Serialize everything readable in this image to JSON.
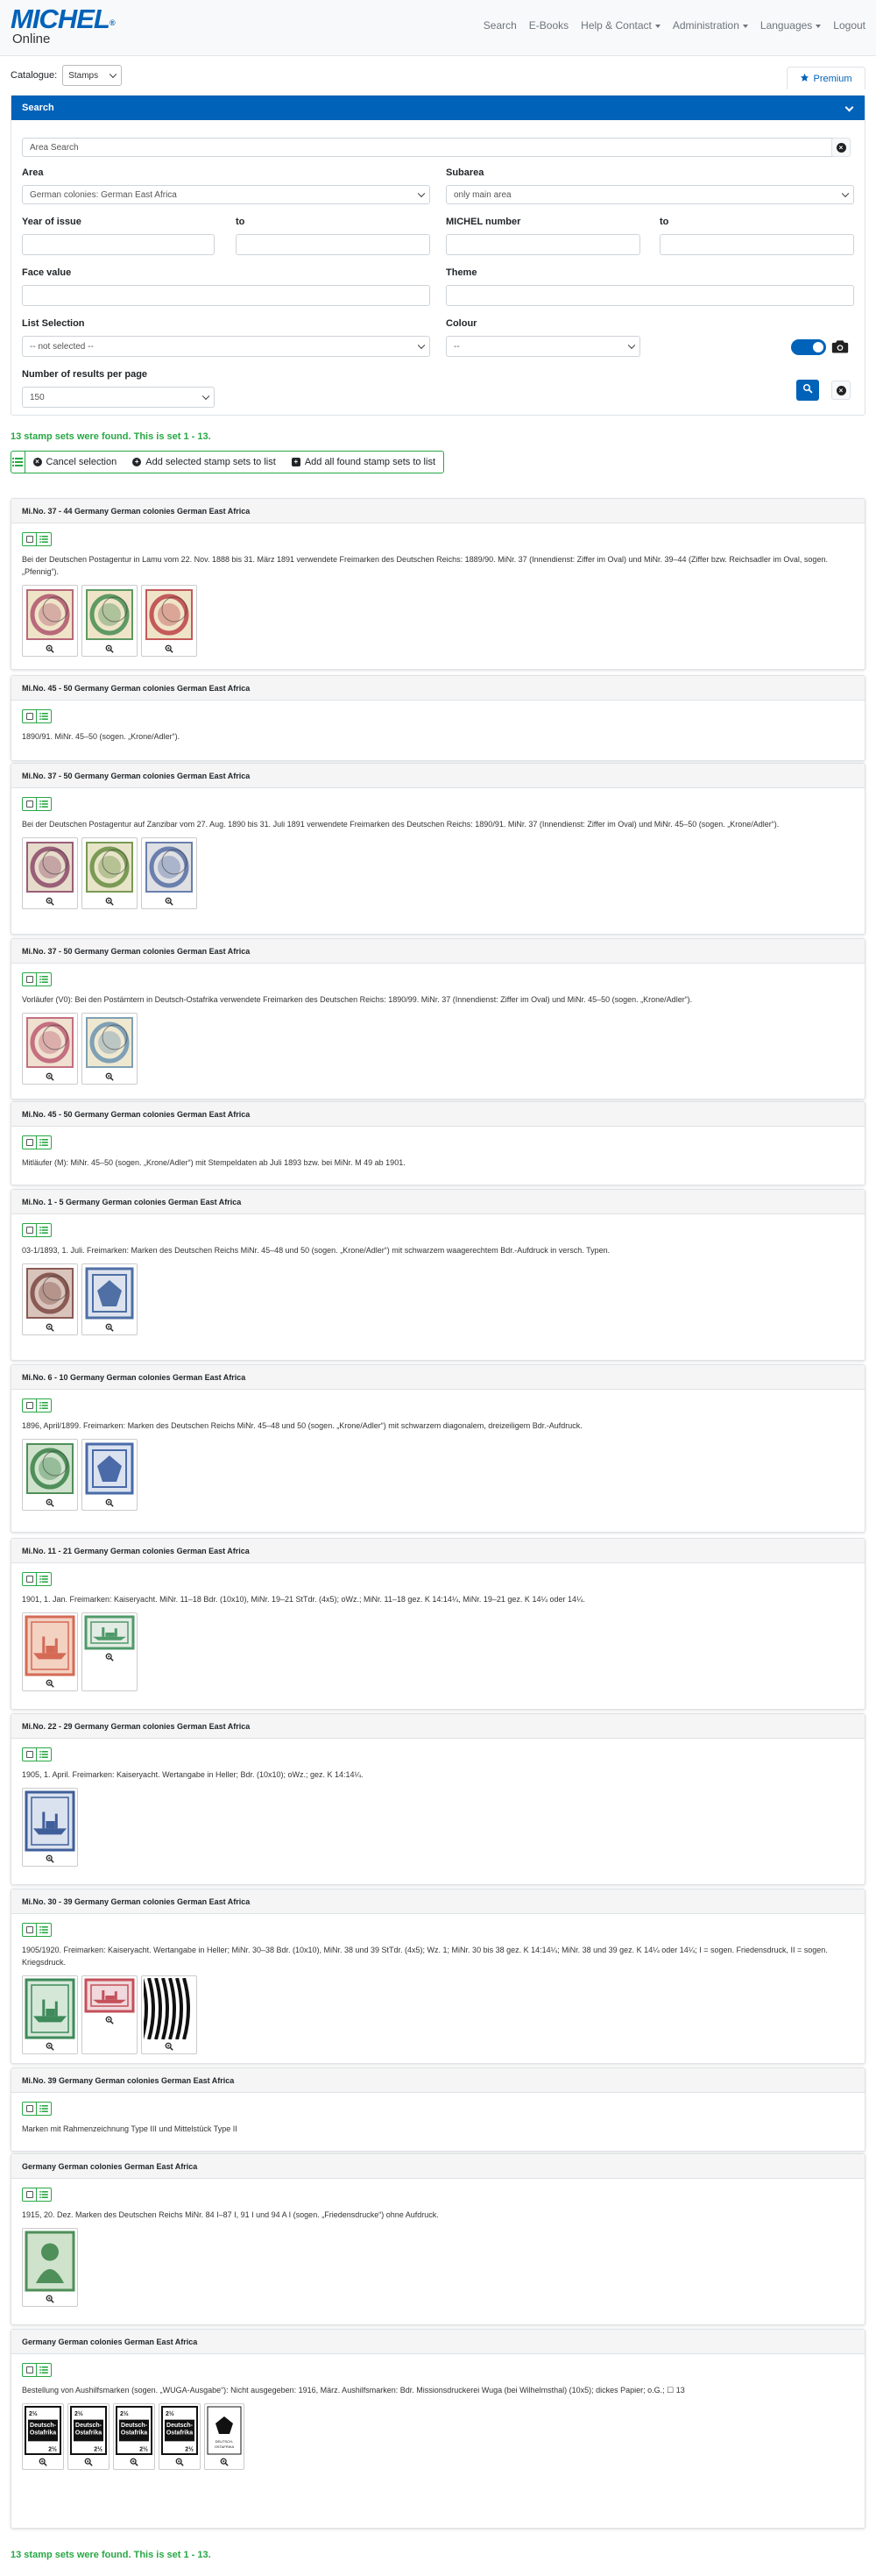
{
  "header": {
    "logo_main": "MICHEL",
    "logo_reg": "®",
    "logo_sub": "Online",
    "nav": [
      {
        "label": "Search",
        "dropdown": false
      },
      {
        "label": "E-Books",
        "dropdown": false
      },
      {
        "label": "Help & Contact",
        "dropdown": true
      },
      {
        "label": "Administration",
        "dropdown": true
      },
      {
        "label": "Languages",
        "dropdown": true
      },
      {
        "label": "Logout",
        "dropdown": false
      }
    ]
  },
  "catalogue": {
    "label": "Catalogue:",
    "value": "Stamps"
  },
  "premium": {
    "label": "Premium"
  },
  "search": {
    "title": "Search",
    "area_search_placeholder": "Area Search",
    "area_label": "Area",
    "area_value": "German colonies: German East Africa",
    "subarea_label": "Subarea",
    "subarea_value": "only main area",
    "year_label": "Year of issue",
    "to_label": "to",
    "michel_label": "MICHEL number",
    "to2_label": "to",
    "face_label": "Face value",
    "theme_label": "Theme",
    "list_label": "List Selection",
    "list_value": "-- not selected --",
    "colour_label": "Colour",
    "colour_value": "--",
    "results_label": "Number of results per page",
    "results_value": "150"
  },
  "found_text": "13 stamp sets were found. This is set 1 - 13.",
  "actions": {
    "cancel": "Cancel selection",
    "add_selected": "Add selected stamp sets to list",
    "add_all": "Add all found stamp sets to list"
  },
  "colors": {
    "primary": "#0062b8",
    "success": "#28a745"
  },
  "sets": [
    {
      "title": "Mi.No. 37 - 44 Germany German colonies German East Africa",
      "desc": "Bei der Deutschen Postagentur in Lamu vom 22. Nov. 1888 bis 31. März 1891 verwendete Freimarken des Deutschen Reichs: 1889/90. MiNr. 37 (Innendienst: Ziffer im Oval) und MiNr. 39–44 (Ziffer bzw. Reichsadler im Oval, sogen. „Pfennig“).",
      "stamps": [
        {
          "kind": "oval",
          "c": "#b86a7a",
          "bg": "#efe4c8"
        },
        {
          "kind": "oval",
          "c": "#5f9a63",
          "bg": "#efe4c8"
        },
        {
          "kind": "oval",
          "c": "#c45a5a",
          "bg": "#efe4c8"
        }
      ]
    },
    {
      "title": "Mi.No. 45 - 50 Germany German colonies German East Africa",
      "desc": "1890/91. MiNr. 45–50 (sogen. „Krone/Adler“).",
      "stamps": []
    },
    {
      "title": "Mi.No. 37 - 50 Germany German colonies German East Africa",
      "desc": "Bei der Deutschen Postagentur auf Zanzibar vom 27. Aug. 1890 bis 31. Juli 1891 verwendete Freimarken des Deutschen Reichs: 1890/91. MiNr. 37 (Innendienst: Ziffer im Oval) und MiNr. 45–50 (sogen. „Krone/Adler“).",
      "stamps": [
        {
          "kind": "oval",
          "c": "#9a5f78",
          "bg": "#e7dccb"
        },
        {
          "kind": "oval",
          "c": "#7a9a55",
          "bg": "#e7e4c8"
        },
        {
          "kind": "oval",
          "c": "#6a7fae",
          "bg": "#dfe0e3"
        }
      ]
    },
    {
      "title": "Mi.No. 37 - 50 Germany German colonies German East Africa",
      "desc": "Vorläufer (V0): Bei den Postämtern in Deutsch-Ostafrika verwendete Freimarken des Deutschen Reichs: 1890/99. MiNr. 37 (Innendienst: Ziffer im Oval) und MiNr. 45–50 (sogen. „Krone/Adler“).",
      "stamps": [
        {
          "kind": "oval",
          "c": "#c47080",
          "bg": "#efe0d0"
        },
        {
          "kind": "oval",
          "c": "#7fa0b5",
          "bg": "#efe8d0"
        }
      ]
    },
    {
      "title": "Mi.No. 45 - 50 Germany German colonies German East Africa",
      "desc": "Mitläufer (M): MiNr. 45–50 (sogen. „Krone/Adler“) mit Stempeldaten ab Juli 1893 bzw. bei MiNr. M 49 ab 1901.",
      "stamps": []
    },
    {
      "title": "Mi.No. 1 - 5 Germany German colonies German East Africa",
      "desc": "03-1/1893, 1. Juli. Freimarken: Marken des Deutschen Reichs MiNr. 45–48 und 50 (sogen. „Krone/Adler“) mit schwarzem waagerechtem Bdr.-Aufdruck in versch. Typen.",
      "stamps": [
        {
          "kind": "oval",
          "c": "#8a5a55",
          "bg": "#d9c4bb"
        },
        {
          "kind": "eagle",
          "c": "#4f6fa5",
          "bg": "#dde3ee"
        }
      ]
    },
    {
      "title": "Mi.No. 6 - 10 Germany German colonies German East Africa",
      "desc": "1896, April/1899. Freimarken: Marken des Deutschen Reichs MiNr. 45–48 und 50 (sogen. „Krone/Adler“) mit schwarzem diagonalem, dreizeiligem Bdr.-Aufdruck.",
      "stamps": [
        {
          "kind": "oval",
          "c": "#4f8f5a",
          "bg": "#cfe2cc"
        },
        {
          "kind": "eagle",
          "c": "#4a6aa8",
          "bg": "#dae2f0"
        }
      ]
    },
    {
      "title": "Mi.No. 11 - 21 Germany German colonies German East Africa",
      "desc": "1901, 1. Jan. Freimarken: Kaiseryacht. MiNr. 11–18 Bdr. (10x10), MiNr. 19–21 StTdr. (4x5); oWz.; MiNr. 11–18 gez. K 14:14¼, MiNr. 19–21 gez. K 14¼ oder 14¼.",
      "stamps": [
        {
          "kind": "ship",
          "c": "#d46a55",
          "bg": "#f3d2c2",
          "h": 70
        },
        {
          "kind": "shipwide",
          "c": "#4f9a6a",
          "bg": "#e3ece4"
        }
      ]
    },
    {
      "title": "Mi.No. 22 - 29 Germany German colonies German East Africa",
      "desc": "1905, 1. April. Freimarken: Kaiseryacht. Wertangabe in Heller; Bdr. (10x10); oWz.; gez. K 14:14¼.",
      "stamps": [
        {
          "kind": "ship",
          "c": "#3f5f9a",
          "bg": "#dbe2ef",
          "h": 70
        }
      ]
    },
    {
      "title": "Mi.No. 30 - 39 Germany German colonies German East Africa",
      "desc": "1905/1920. Freimarken: Kaiseryacht. Wertangabe in Heller; MiNr. 30–38 Bdr. (10x10), MiNr. 38 und 39 StTdr. (4x5); Wz. 1; MiNr. 30 bis 38 gez. K 14:14¼; MiNr. 38 und 39 gez. K 14¼ oder 14¼; I = sogen. Friedensdruck, II = sogen. Kriegsdruck.",
      "stamps": [
        {
          "kind": "ship",
          "c": "#3f8a5a",
          "bg": "#d5e8d8",
          "h": 70
        },
        {
          "kind": "shipwide",
          "c": "#c4505a",
          "bg": "#f0d8dc"
        },
        {
          "kind": "pattern",
          "c": "#111",
          "bg": "#fff",
          "h": 70
        }
      ]
    },
    {
      "title": "Mi.No. 39 Germany German colonies German East Africa",
      "desc": "Marken mit Rahmenzeichnung Type III und Mittelstück Type II",
      "stamps": []
    },
    {
      "title": "Germany German colonies German East Africa",
      "desc": "1915, 20. Dez. Marken des Deutschen Reichs MiNr. 84 I–87 I, 91 I und 94 A I (sogen. „Friedensdrucke“) ohne Aufdruck.",
      "stamps": [
        {
          "kind": "germania",
          "c": "#4f8f5a",
          "bg": "#cfe2cc",
          "h": 70
        }
      ]
    },
    {
      "title": "Germany German colonies German East Africa",
      "desc": "Bestellung von Aushilfsmarken (sogen. „WUGA-Ausgabe“): Nicht ausgegeben: 1916, März. Aushilfsmarken: Bdr. Missionsdruckerei Wuga (bei Wilhelmsthal) (10x5); dickes Papier; o.G.; ☐ 13",
      "stamps": [
        {
          "kind": "wuga",
          "t1": "2½ Heller",
          "t2": "Deutsch-",
          "t3": "Ostafrika",
          "n": "2½",
          "big": true
        },
        {
          "kind": "wuga",
          "t1": "2½ Heller",
          "t2": "Deutsch-",
          "t3": "Ostafrika",
          "n": "2½",
          "big": true
        },
        {
          "kind": "wuga",
          "t1": "2½ Heller",
          "t2": "Deutsch-",
          "t3": "Ostafrika",
          "n": "2½",
          "big": true
        },
        {
          "kind": "wuga",
          "t1": "2½ Heller",
          "t2": "Deutsch-",
          "t3": "Ostafrika",
          "n": "2½",
          "big": true
        },
        {
          "kind": "eaglebw",
          "t2": "DEUTSCH-",
          "t3": "OSTAFRIKA",
          "n": "",
          "big": false
        }
      ]
    }
  ]
}
